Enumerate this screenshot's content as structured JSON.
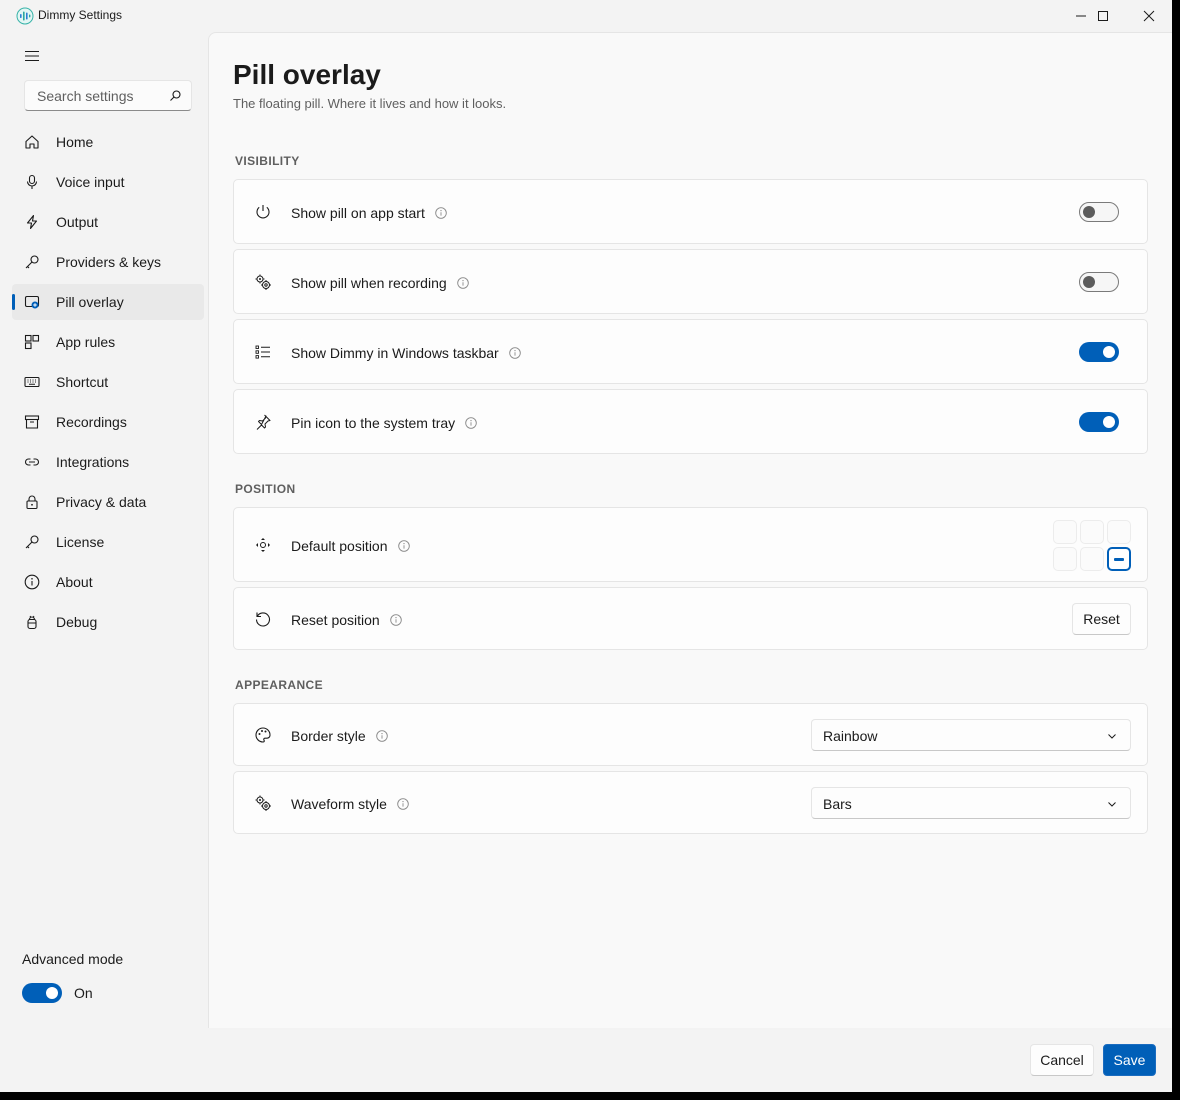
{
  "window": {
    "title": "Dimmy Settings"
  },
  "sidebar": {
    "search_placeholder": "Search settings",
    "items": [
      {
        "label": "Home",
        "icon": "home-icon"
      },
      {
        "label": "Voice input",
        "icon": "microphone-icon"
      },
      {
        "label": "Output",
        "icon": "lightning-icon"
      },
      {
        "label": "Providers & keys",
        "icon": "key-icon"
      },
      {
        "label": "Pill overlay",
        "icon": "pill-overlay-icon",
        "active": true
      },
      {
        "label": "App rules",
        "icon": "app-rules-icon"
      },
      {
        "label": "Shortcut",
        "icon": "keyboard-icon"
      },
      {
        "label": "Recordings",
        "icon": "archive-icon"
      },
      {
        "label": "Integrations",
        "icon": "link-icon"
      },
      {
        "label": "Privacy & data",
        "icon": "lock-icon"
      },
      {
        "label": "License",
        "icon": "key-icon"
      },
      {
        "label": "About",
        "icon": "info-icon"
      },
      {
        "label": "Debug",
        "icon": "bug-icon"
      }
    ],
    "advanced_mode": {
      "label": "Advanced mode",
      "state_label": "On",
      "on": true
    }
  },
  "page": {
    "title": "Pill overlay",
    "subtitle": "The floating pill. Where it lives and how it looks."
  },
  "visibility": {
    "heading": "VISIBILITY",
    "rows": [
      {
        "label": "Show pill on app start",
        "icon": "power-icon",
        "on": false
      },
      {
        "label": "Show pill when recording",
        "icon": "gears-icon",
        "on": false
      },
      {
        "label": "Show Dimmy in Windows taskbar",
        "icon": "list-icon",
        "on": true
      },
      {
        "label": "Pin icon to the system tray",
        "icon": "pin-icon",
        "on": true
      }
    ]
  },
  "position": {
    "heading": "POSITION",
    "default_label": "Default position",
    "default_selected": "bottom-right",
    "reset_label": "Reset position",
    "reset_button": "Reset"
  },
  "appearance": {
    "heading": "APPEARANCE",
    "border_label": "Border style",
    "border_value": "Rainbow",
    "waveform_label": "Waveform style",
    "waveform_value": "Bars"
  },
  "footer": {
    "cancel": "Cancel",
    "save": "Save"
  },
  "colors": {
    "accent": "#005fb8",
    "background": "#f3f3f3",
    "card": "#fdfdfd"
  }
}
